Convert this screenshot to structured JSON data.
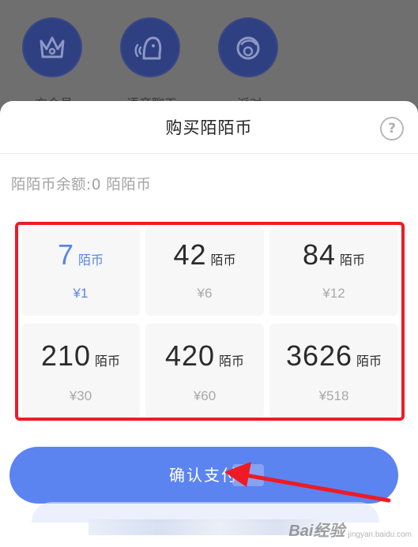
{
  "background": {
    "items": [
      {
        "label": "充会员",
        "icon": "crown-icon"
      },
      {
        "label": "语音聊天",
        "icon": "voice-chat-icon"
      },
      {
        "label": "派对",
        "icon": "party-icon"
      }
    ]
  },
  "sheet": {
    "title": "购买陌陌币",
    "help": "?",
    "balance": "陌陌币余额:0 陌陌币"
  },
  "options": [
    {
      "amount": "7",
      "unit": "陌币",
      "price": "¥1",
      "selected": true
    },
    {
      "amount": "42",
      "unit": "陌币",
      "price": "¥6",
      "selected": false
    },
    {
      "amount": "84",
      "unit": "陌币",
      "price": "¥12",
      "selected": false
    },
    {
      "amount": "210",
      "unit": "陌币",
      "price": "¥30",
      "selected": false
    },
    {
      "amount": "420",
      "unit": "陌币",
      "price": "¥60",
      "selected": false
    },
    {
      "amount": "3626",
      "unit": "陌币",
      "price": "¥518",
      "selected": false
    }
  ],
  "confirm": {
    "label": "确认支付"
  },
  "watermark": {
    "text": "Bai经验",
    "sub": "jingyan.baidu.com"
  },
  "colors": {
    "accent": "#5b84f1",
    "selected_text": "#5b85e6",
    "highlight_border": "#ee1b24",
    "overlay": "#6f6f6f"
  }
}
